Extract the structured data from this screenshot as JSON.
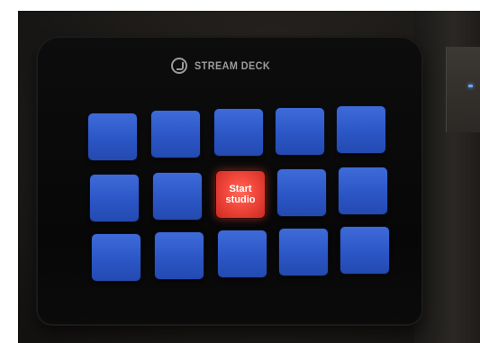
{
  "device": {
    "brand": "STREAM DECK"
  },
  "buttons": {
    "active_label_line1": "Start",
    "active_label_line2": "studio"
  },
  "colors": {
    "key_blue": "#2f59c9",
    "key_active_red": "#f2473b",
    "device_body": "#080808"
  }
}
